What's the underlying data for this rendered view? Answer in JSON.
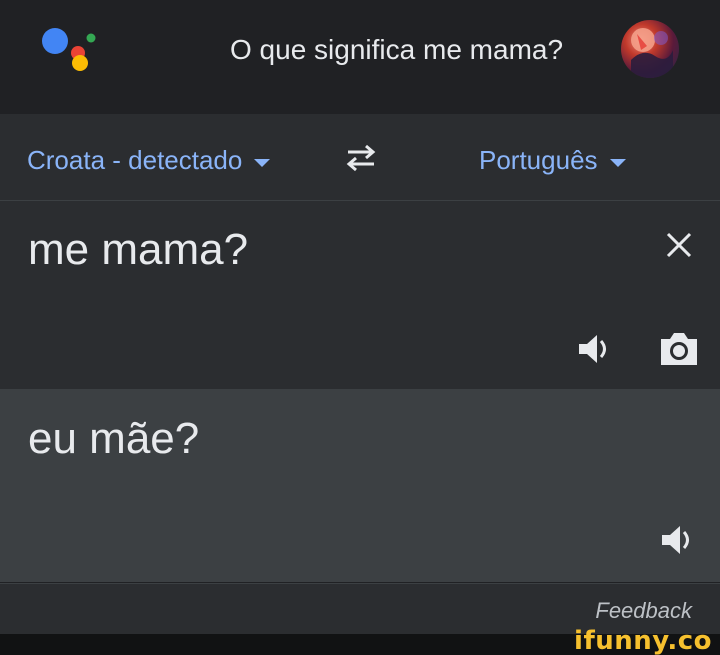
{
  "assistant": {
    "query": "O que significa me mama?",
    "logo_icon": "google-assistant-icon",
    "logo_colors": [
      "#4285f4",
      "#ea4335",
      "#fbbc04",
      "#34a853"
    ]
  },
  "translate": {
    "source_language": "Croata - detectado",
    "target_language": "Português",
    "swap_icon": "swap-arrows-icon",
    "source_text": "me mama?",
    "result_text": "eu mãe?",
    "accent_color": "#8ab4f8"
  },
  "icons": {
    "clear": "close-icon",
    "speaker": "speaker-icon",
    "camera": "camera-icon"
  },
  "footer": {
    "feedback_label": "Feedback"
  },
  "watermark": {
    "text": "ifunny.co"
  }
}
